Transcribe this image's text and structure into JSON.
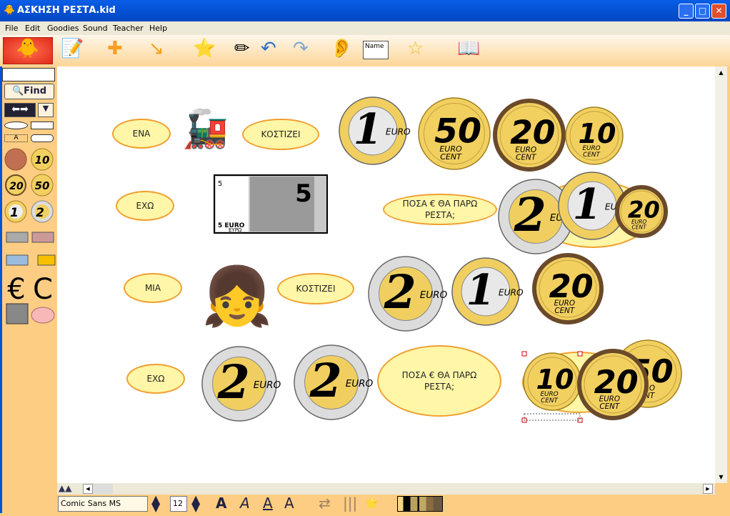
{
  "window": {
    "title": "ΑΣΚΗΣΗ ΡΕΣΤΑ.kid",
    "minimize": "_",
    "maximize": "□",
    "close": "✕"
  },
  "menu": [
    "File",
    "Edit",
    "Goodies",
    "Sound",
    "Teacher",
    "Help"
  ],
  "toolbar": {
    "icons": [
      "draw-text-icon",
      "add-node-icon",
      "link-node-icon",
      "goodies-box-icon",
      "eraser-icon",
      "undo-icon",
      "redo-icon",
      "sound-ear-icon",
      "name-tag-icon",
      "star-magic-icon",
      "storybook-icon"
    ],
    "name_tag": "Name"
  },
  "sidebar": {
    "find_label": "Find",
    "text_tool_label": "A",
    "symbols": [
      "€",
      "C"
    ],
    "coins": [
      "1c",
      "10",
      "20",
      "50",
      "1",
      "2"
    ]
  },
  "canvas": {
    "labels": {
      "ena": "ΕΝΑ",
      "kostizei1": "ΚΟΣΤΙΖΕΙ",
      "exo1": "ΕΧΩ",
      "posa1": "ΠΟΣΑ €  ΘΑ ΠΑΡΩ ΡΕΣΤΑ;",
      "mia": "ΜΙΑ",
      "kostizei2": "ΚΟΣΤΙΖΕΙ",
      "exo2": "ΕΧΩ",
      "posa2": "ΠΟΣΑ €   ΘΑ ΠΑΡΩ ΡΕΣΤΑ;"
    },
    "banknote": {
      "value": "5",
      "currency": "EURO",
      "currency_gr": "ΕΥΡΩ"
    },
    "coins": [
      {
        "value": "1",
        "unit": "EURO"
      },
      {
        "value": "50",
        "unit": "EURO CENT"
      },
      {
        "value": "20",
        "unit": "EURO CENT"
      },
      {
        "value": "10",
        "unit": "EURO CENT"
      },
      {
        "value": "2",
        "unit": "EURO"
      },
      {
        "value": "1",
        "unit": "EURO"
      },
      {
        "value": "20",
        "unit": "EURO CENT"
      },
      {
        "value": "2",
        "unit": "EURO"
      },
      {
        "value": "1",
        "unit": "EURO"
      },
      {
        "value": "20",
        "unit": "EURO CENT"
      },
      {
        "value": "2",
        "unit": "EURO"
      },
      {
        "value": "2",
        "unit": "EURO"
      },
      {
        "value": "50",
        "unit": "EURO CENT"
      },
      {
        "value": "10",
        "unit": "EURO CENT"
      },
      {
        "value": "20",
        "unit": "EURO CENT"
      }
    ]
  },
  "format_bar": {
    "font": "Comic Sans MS",
    "size": "12",
    "bold": "A",
    "italic": "A",
    "underline": "A",
    "color": "A"
  }
}
